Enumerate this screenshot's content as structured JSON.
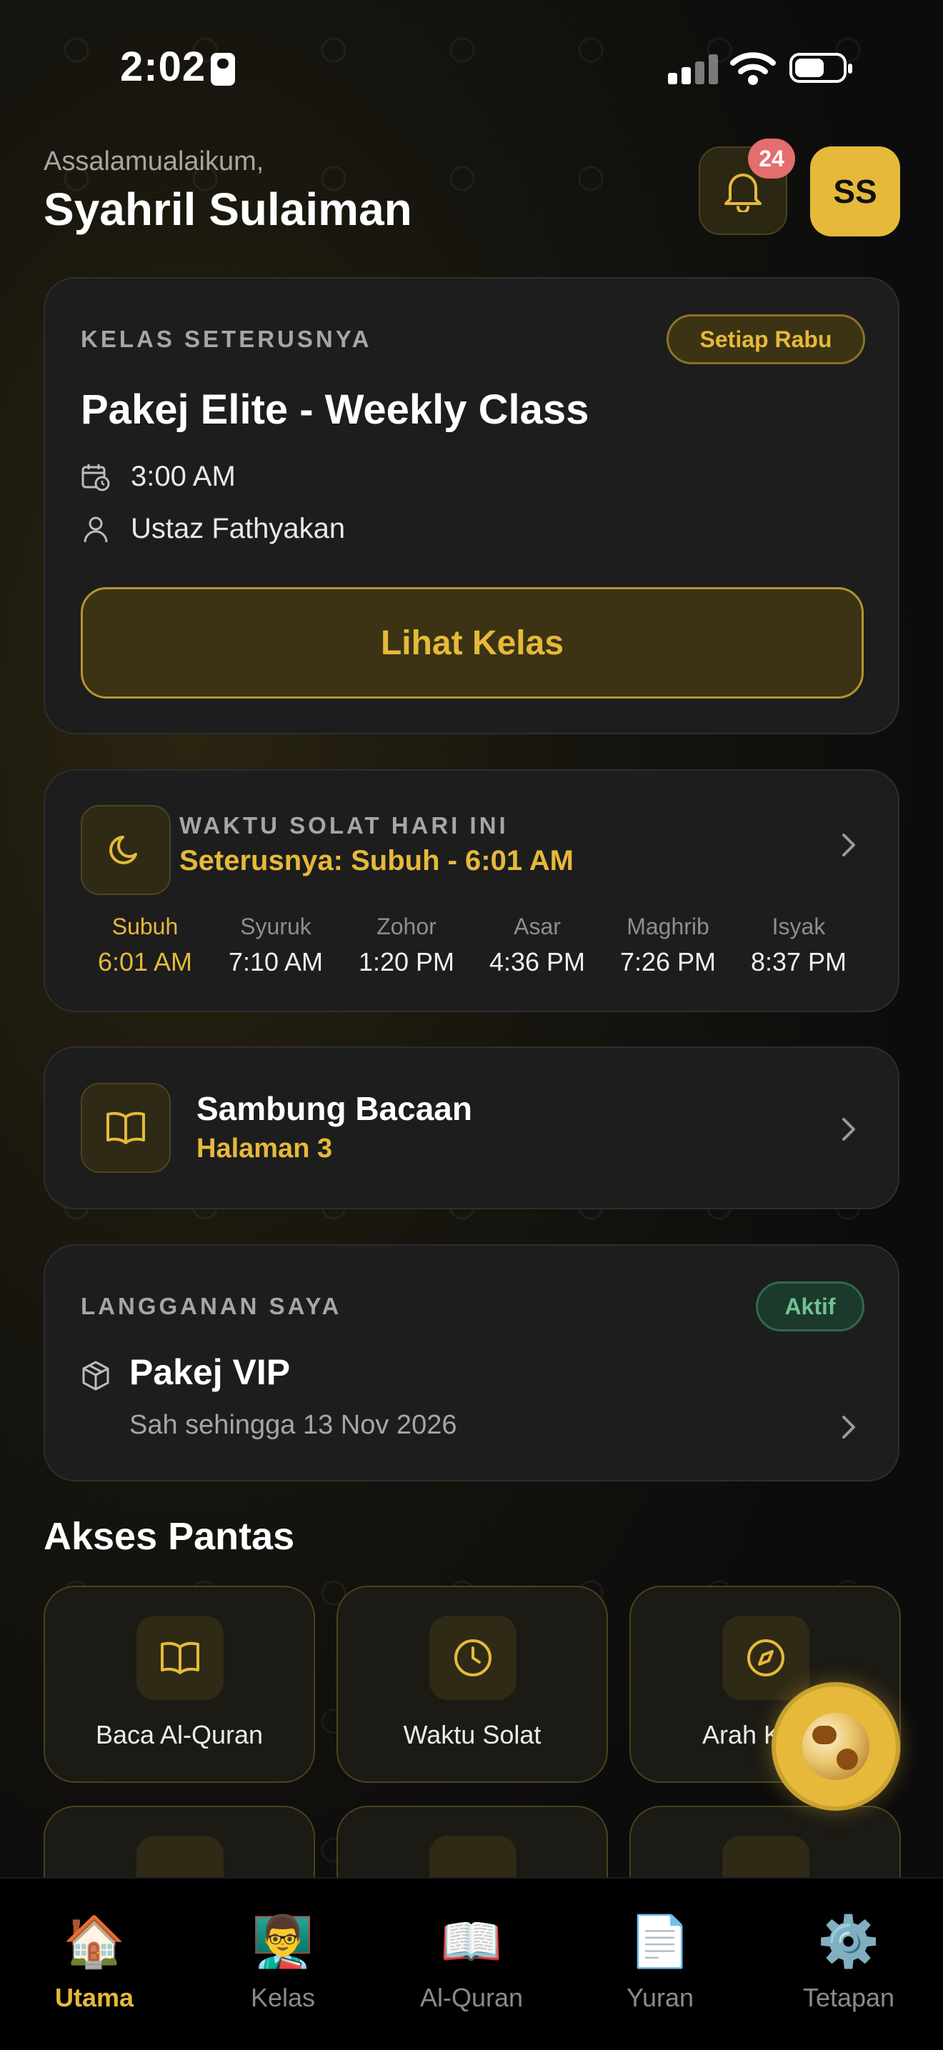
{
  "status_bar": {
    "time": "2:02"
  },
  "header": {
    "greeting": "Assalamualaikum,",
    "name": "Syahril Sulaiman",
    "notification_count": "24",
    "avatar_initials": "SS"
  },
  "next_class": {
    "label": "KELAS SETERUSNYA",
    "schedule_badge": "Setiap Rabu",
    "title": "Pakej Elite - Weekly Class",
    "time": "3:00 AM",
    "teacher": "Ustaz Fathyakan",
    "button": "Lihat Kelas"
  },
  "prayer": {
    "label": "WAKTU SOLAT HARI INI",
    "next": "Seterusnya: Subuh - 6:01 AM",
    "times": [
      {
        "name": "Subuh",
        "time": "6:01 AM"
      },
      {
        "name": "Syuruk",
        "time": "7:10 AM"
      },
      {
        "name": "Zohor",
        "time": "1:20 PM"
      },
      {
        "name": "Asar",
        "time": "4:36 PM"
      },
      {
        "name": "Maghrib",
        "time": "7:26 PM"
      },
      {
        "name": "Isyak",
        "time": "8:37 PM"
      }
    ]
  },
  "continue_reading": {
    "title": "Sambung Bacaan",
    "subtitle": "Halaman 3"
  },
  "subscription": {
    "label": "LANGGANAN SAYA",
    "status": "Aktif",
    "plan": "Pakej VIP",
    "validity": "Sah sehingga 13 Nov 2026"
  },
  "quick_access": {
    "title": "Akses Pantas",
    "items": [
      {
        "label": "Baca Al-Quran",
        "icon": "book-open-icon"
      },
      {
        "label": "Waktu Solat",
        "icon": "clock-icon"
      },
      {
        "label": "Arah Kiblat",
        "icon": "compass-icon"
      }
    ]
  },
  "tabs": [
    {
      "label": "Utama",
      "icon": "house-icon"
    },
    {
      "label": "Kelas",
      "icon": "teacher-icon"
    },
    {
      "label": "Al-Quran",
      "icon": "quran-icon"
    },
    {
      "label": "Yuran",
      "icon": "receipt-icon"
    },
    {
      "label": "Tetapan",
      "icon": "gear-icon"
    }
  ],
  "colors": {
    "accent": "#e6b93a",
    "active_green": "#6fc391",
    "badge_red": "#e46d6d",
    "card_bg": "#1d1d1d"
  }
}
